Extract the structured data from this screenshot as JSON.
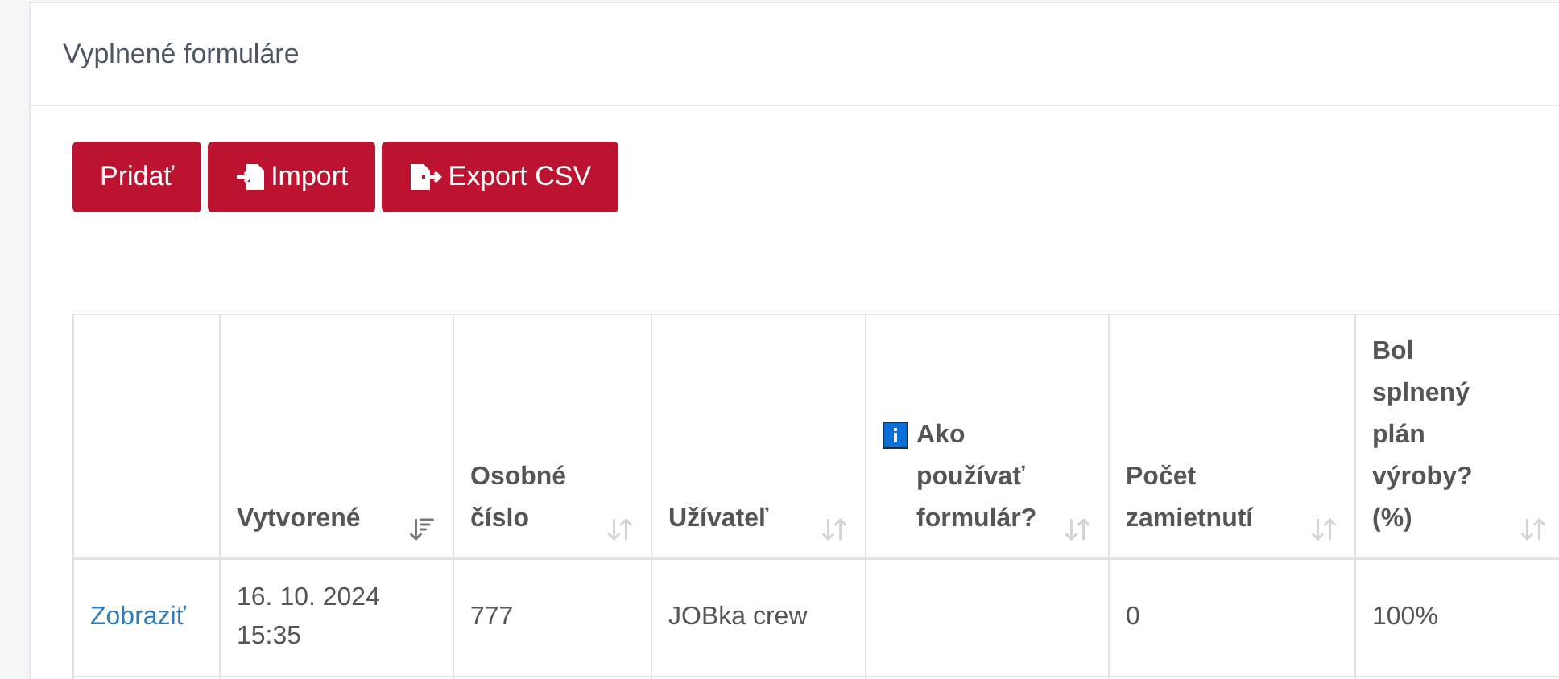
{
  "card": {
    "title": "Vyplnené formuláre"
  },
  "buttons": [
    {
      "label": "Pridať",
      "kind": "plain"
    },
    {
      "label": "Import",
      "kind": "import"
    },
    {
      "label": "Export CSV",
      "kind": "export"
    }
  ],
  "table": {
    "columns": [
      {},
      {
        "label": "Vytvorené",
        "sorted": true
      },
      {
        "label": "Osobné číslo",
        "sorted": false
      },
      {
        "label": "Užívateľ",
        "sorted": false
      },
      {
        "label": "Ako používať formulár?",
        "sorted": false,
        "info": true
      },
      {
        "label": "Počet zamietnutí",
        "sorted": false
      },
      {
        "label": "Bol splnený plán výroby? (%)",
        "sorted": false
      }
    ],
    "rows": [
      {
        "cells": [
          {
            "text": "Zobraziť",
            "kind": "link"
          },
          {
            "text": "16. 10. 2024 15:35",
            "kind": "text"
          },
          {
            "text": "777",
            "kind": "text"
          },
          {
            "text": "JOBka crew",
            "kind": "text"
          },
          {
            "kind": "empty"
          },
          {
            "text": "0",
            "kind": "text"
          },
          {
            "text": "100%",
            "kind": "text"
          }
        ]
      }
    ]
  }
}
